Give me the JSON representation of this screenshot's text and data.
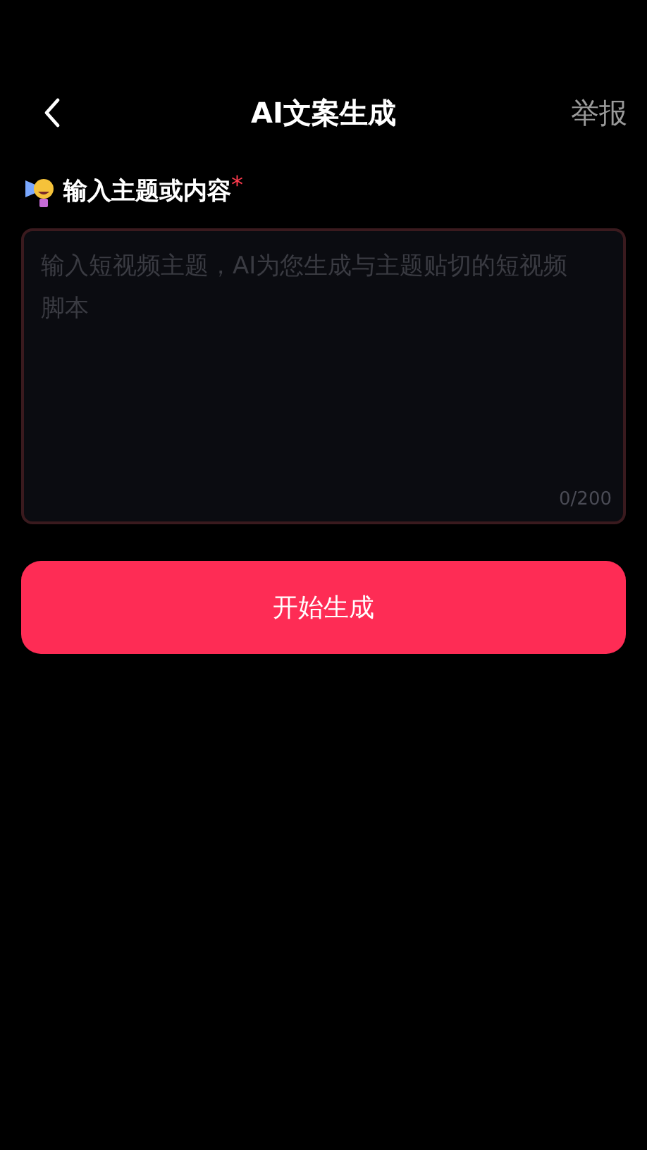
{
  "header": {
    "title": "AI文案生成",
    "report": "举报"
  },
  "field": {
    "label": "输入主题或内容",
    "required_mark": "*",
    "placeholder": "输入短视频主题，AI为您生成与主题贴切的短视频脚本",
    "counter": "0/200"
  },
  "button": {
    "label": "开始生成"
  }
}
